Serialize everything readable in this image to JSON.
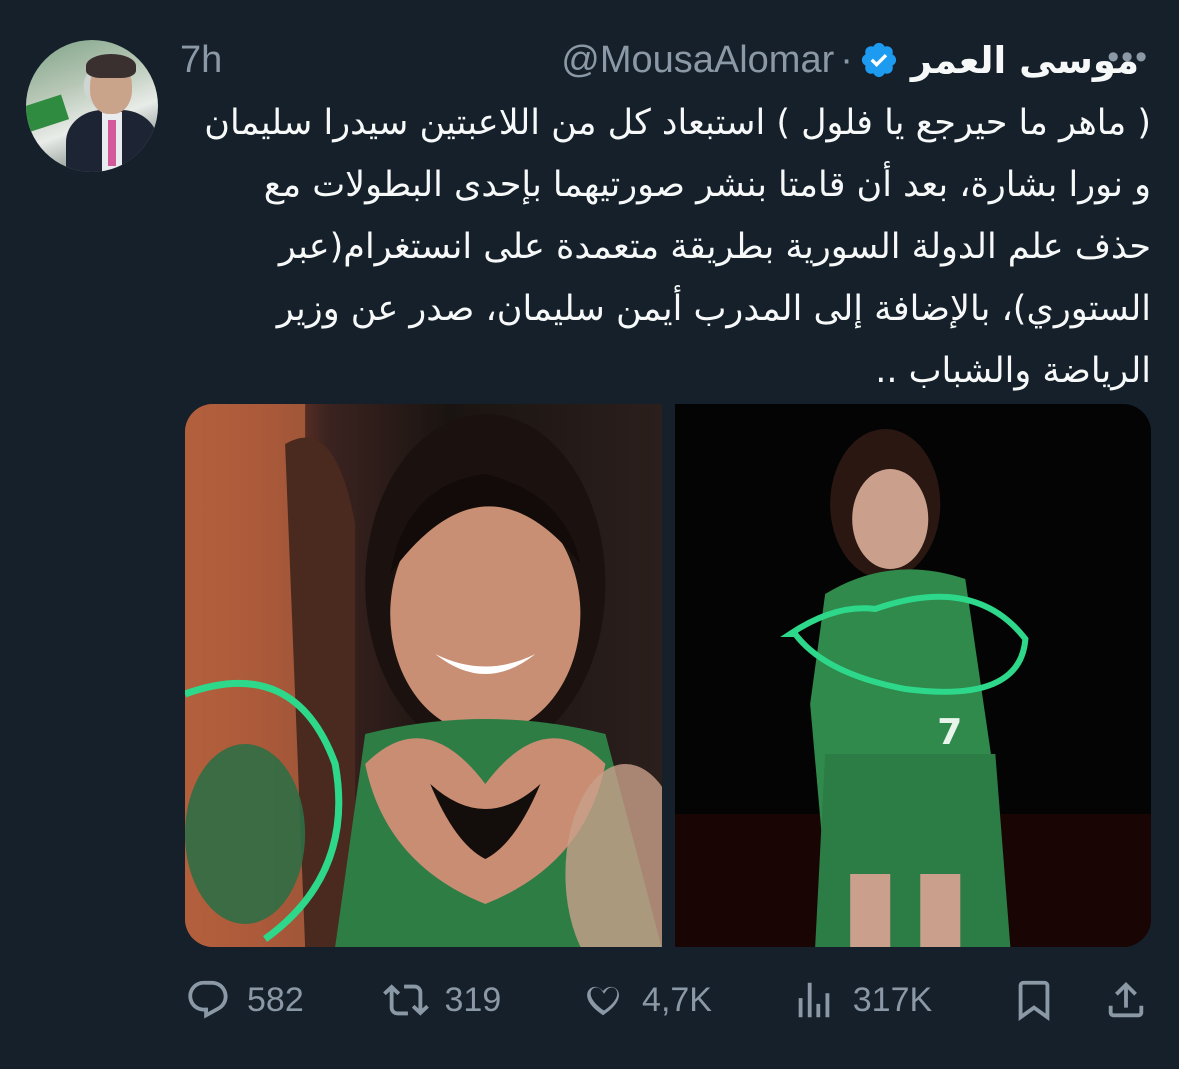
{
  "author": {
    "name": "موسى العمر",
    "handle": "@MousaAlomar",
    "separator": "·",
    "time": "7h",
    "verified": true
  },
  "more_label": "•••",
  "tweet": {
    "text": "( ماهر ما حيرجع يا فلول ) استبعاد كل من اللاعبتين سيدرا سليمان و نورا بشارة، بعد أن قامتا بنشر صورتيهما بإحدى البطولات مع حذف علم الدولة السورية بطريقة متعمدة على انستغرام(عبر الستوري)، بالإضافة إلى المدرب أيمن سليمان، صدر عن وزير الرياضة والشباب .."
  },
  "media": [
    {
      "subject": "player-heart-hands-photo",
      "accent": "#2ed88a"
    },
    {
      "subject": "player-green-jersey-photo",
      "accent": "#2ed88a"
    }
  ],
  "stats": {
    "replies": "582",
    "reposts": "319",
    "likes": "4,7K",
    "views": "317K"
  },
  "colors": {
    "background": "#15202b",
    "text": "#f7f9f9",
    "secondary": "#8b98a5",
    "verified": "#1d9bf0"
  }
}
